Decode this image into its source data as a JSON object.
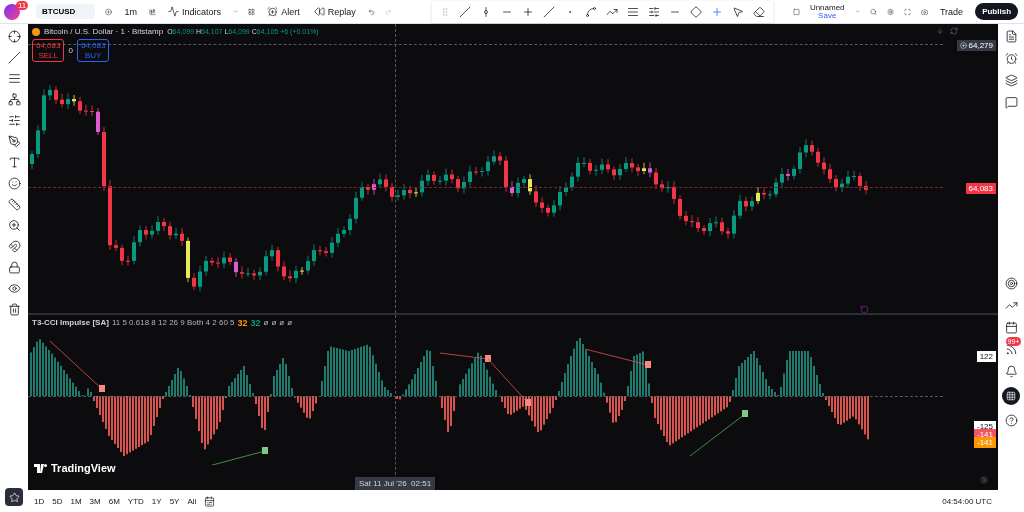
{
  "header": {
    "badge": "11",
    "symbol": "BTCUSD",
    "interval": "1m",
    "indicators": "Indicators",
    "alert": "Alert",
    "replay": "Replay",
    "layout_name": "Unnamed",
    "layout_status": "Save",
    "trade": "Trade",
    "publish": "Publish"
  },
  "chart": {
    "title": "Bitcoin / U.S. Dollar · 1 · Bitstamp",
    "ohlc": [
      {
        "label": "O",
        "value": "64,099"
      },
      {
        "label": "H",
        "value": "64,107"
      },
      {
        "label": "L",
        "value": "64,099"
      },
      {
        "label": "C",
        "value": "64,105"
      }
    ],
    "change": "+6 (+0.01%)",
    "sell": {
      "price": "64,083",
      "label": "SELL"
    },
    "spread": "0",
    "buy": {
      "price": "64,083",
      "label": "BUY"
    },
    "price_labels": [
      {
        "text": "64,279",
        "color": "#363a45"
      },
      {
        "text": "64,083",
        "color": "#f23645"
      }
    ]
  },
  "indicator": {
    "name": "T3-CCI Impulse [SA]",
    "params": "11 5 0.618 8 12 26 9 Both 4 2 60 5",
    "values": [
      {
        "text": "32",
        "color": "#ff9800"
      },
      {
        "text": "32",
        "color": "#089981"
      }
    ],
    "extras": [
      "ø",
      "ø",
      "ø",
      "ø"
    ],
    "scale_labels": [
      {
        "text": "122",
        "color": "#ffffff"
      },
      {
        "text": "-125",
        "color": "#ffffff"
      },
      {
        "text": "-141",
        "color": "#f7525f"
      },
      {
        "text": "-141",
        "color": "#ff9800"
      }
    ],
    "logo": "TradingView"
  },
  "crosshair_time": "Sat 11 Jul '26  02:51",
  "ranges": [
    "1D",
    "5D",
    "1M",
    "3M",
    "6M",
    "YTD",
    "1Y",
    "5Y",
    "All"
  ],
  "clock": "04:54:00 UTC",
  "notifications": "99+"
}
